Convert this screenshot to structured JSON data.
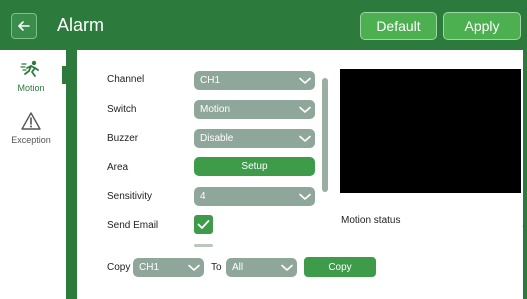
{
  "header": {
    "title": "Alarm",
    "back_icon": "back-arrow-icon",
    "default_label": "Default",
    "apply_label": "Apply"
  },
  "sidebar": {
    "items": [
      {
        "label": "Motion",
        "icon": "motion-icon",
        "active": true
      },
      {
        "label": "Exception",
        "icon": "warning-icon",
        "active": false
      }
    ]
  },
  "form": {
    "channel": {
      "label": "Channel",
      "value": "CH1"
    },
    "switch": {
      "label": "Switch",
      "value": "Motion"
    },
    "buzzer": {
      "label": "Buzzer",
      "value": "Disable"
    },
    "area": {
      "label": "Area",
      "button_label": "Setup"
    },
    "sensitivity": {
      "label": "Sensitivity",
      "value": "4"
    },
    "send_email": {
      "label": "Send Email",
      "checked": true
    }
  },
  "preview": {
    "motion_status_label": "Motion status"
  },
  "copy": {
    "copy_label": "Copy",
    "from_value": "CH1",
    "to_label": "To",
    "to_value": "All",
    "button_label": "Copy"
  },
  "colors": {
    "brand_green": "#2c7a3c",
    "button_green": "#3d9b4a",
    "select_gray": "#8fa79a"
  }
}
